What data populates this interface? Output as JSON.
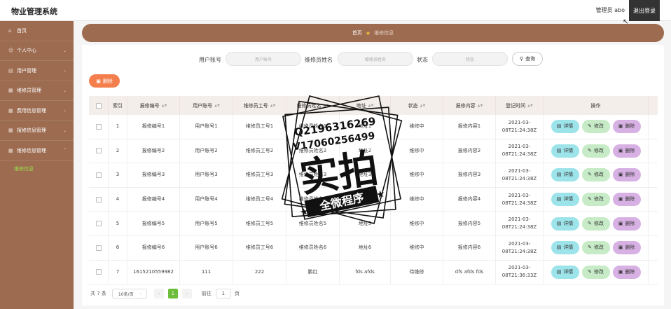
{
  "app": {
    "title": "物业管理系统",
    "user": "管理员 abo",
    "logout": "退出登录"
  },
  "sidebar": {
    "items": [
      {
        "label": "首页",
        "icon": "home-icon"
      },
      {
        "label": "个人中心",
        "icon": "user-icon"
      },
      {
        "label": "用户管理",
        "icon": "users-icon"
      },
      {
        "label": "维修员管理",
        "icon": "grid-icon"
      },
      {
        "label": "费用信息管理",
        "icon": "grid-icon"
      },
      {
        "label": "报修信息管理",
        "icon": "grid-icon"
      },
      {
        "label": "维修信息管理",
        "icon": "grid-icon"
      }
    ],
    "sub_item": "维修信息"
  },
  "breadcrumb": {
    "home": "首页",
    "current": "维修信息"
  },
  "search": {
    "account_label": "用户账号",
    "account_placeholder": "用户账号",
    "repairer_label": "维修员姓名",
    "repairer_placeholder": "维修员姓名",
    "status_label": "状态",
    "status_placeholder": "状态",
    "button": "查询"
  },
  "toolbar": {
    "delete": "删除"
  },
  "table": {
    "headers": [
      "",
      "索引",
      "报修编号",
      "用户账号",
      "维修员工号",
      "维修员姓名",
      "地址",
      "状态",
      "报修内容",
      "登记时间",
      "操作"
    ],
    "sortable": [
      false,
      false,
      true,
      true,
      true,
      true,
      true,
      true,
      true,
      true,
      false
    ],
    "rows": [
      [
        "1",
        "报修编号1",
        "用户账号1",
        "维修员工号1",
        "维修员姓名1",
        "地址1",
        "维修中",
        "报修内容1",
        "2021-03-08T21:24:38Z"
      ],
      [
        "2",
        "报修编号2",
        "用户账号2",
        "维修员工号2",
        "维修员姓名2",
        "地址2",
        "维修中",
        "报修内容2",
        "2021-03-08T21:24:38Z"
      ],
      [
        "3",
        "报修编号3",
        "用户账号3",
        "维修员工号3",
        "维修员姓名3",
        "地址3",
        "维修中",
        "报修内容3",
        "2021-03-08T21:24:38Z"
      ],
      [
        "4",
        "报修编号4",
        "用户账号4",
        "维修员工号4",
        "维修员姓名4",
        "地址4",
        "维修中",
        "报修内容4",
        "2021-03-08T21:24:38Z"
      ],
      [
        "5",
        "报修编号5",
        "用户账号5",
        "维修员工号5",
        "维修员姓名5",
        "地址5",
        "维修中",
        "报修内容5",
        "2021-03-08T21:24:38Z"
      ],
      [
        "6",
        "报修编号6",
        "用户账号6",
        "维修员工号6",
        "维修员姓名6",
        "地址6",
        "维修中",
        "报修内容6",
        "2021-03-08T21:24:38Z"
      ],
      [
        "7",
        "1615210559982",
        "111",
        "222",
        "鹏红",
        "fds afds",
        "待维修",
        "dfs afds fds",
        "2021-03-08T21:36:33Z"
      ]
    ],
    "actions": {
      "detail": "详情",
      "edit": "修改",
      "remove": "删除"
    }
  },
  "pagination": {
    "total": "共 7 条",
    "page_size": "10条/页",
    "current": "1",
    "goto": "前往",
    "goto_value": "1",
    "page_suffix": "页"
  },
  "watermark": {
    "line1": "Q2196316269",
    "line2": "V17060256499",
    "big": "实拍",
    "band": "全微程序"
  },
  "colors": {
    "brand": "#9c6b50",
    "accent": "#f47f4d",
    "active_green": "#6cbd3b",
    "sub_menu_green": "#9be34b"
  }
}
